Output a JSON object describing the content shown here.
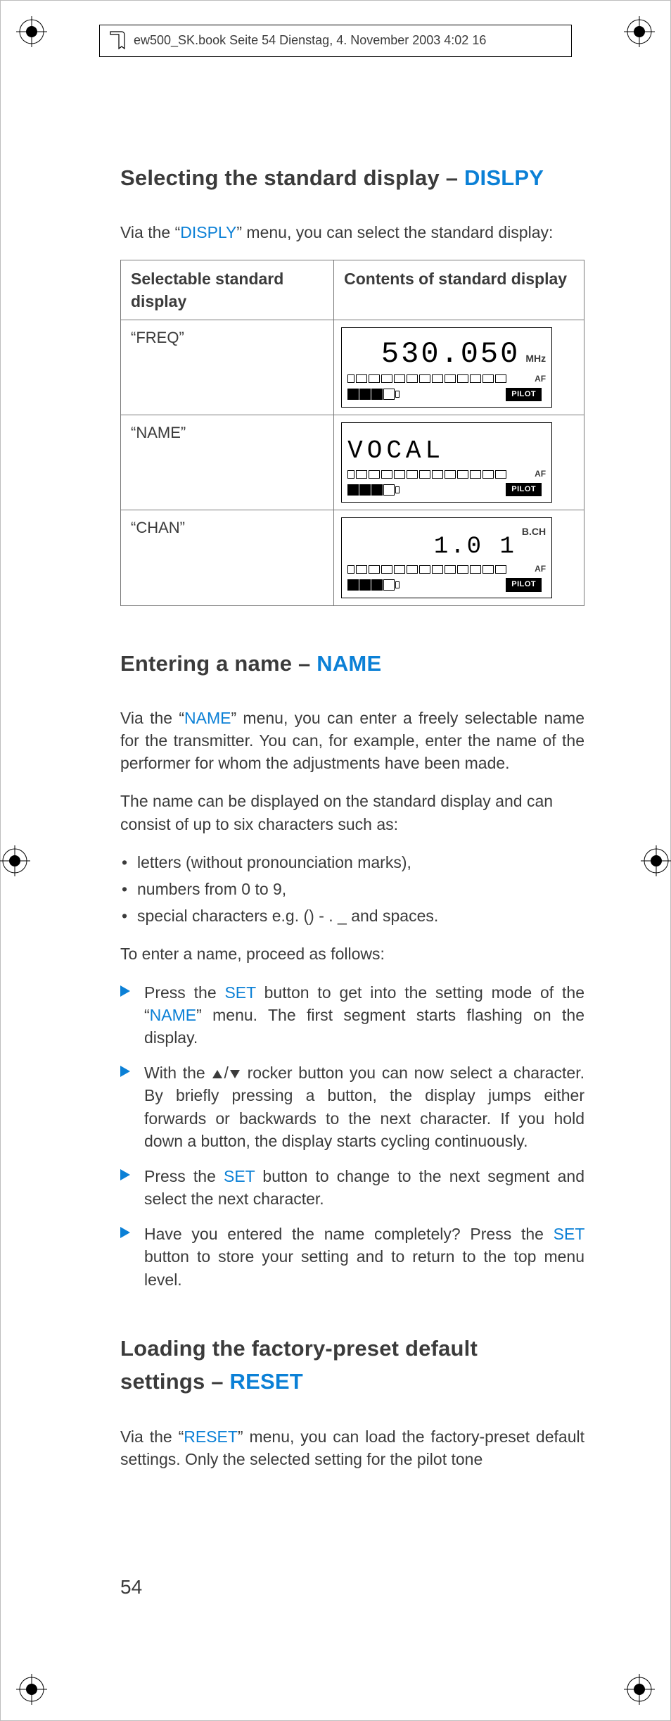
{
  "running_head": {
    "text": "ew500_SK.book  Seite 54  Dienstag, 4. November 2003  4:02 16"
  },
  "page_number": "54",
  "section1": {
    "title_pre": "Selecting the standard display – ",
    "title_hl": "DISLPY",
    "intro_pre": "Via the “",
    "intro_hl": "DISPLY",
    "intro_post": "” menu, you can select the standard display:",
    "table": {
      "header_left": "Selectable standard display",
      "header_right": "Contents of standard display",
      "rows": [
        {
          "label": "“FREQ”",
          "lcd": {
            "value": "530.050",
            "unit": "MHz",
            "af": "AF",
            "pilot": "PILOT"
          }
        },
        {
          "label": "“NAME”",
          "lcd": {
            "value": "VOCAL",
            "unit": "",
            "af": "AF",
            "pilot": "PILOT"
          }
        },
        {
          "label": "“CHAN”",
          "lcd": {
            "value": "1.0 1",
            "unit": "B.CH",
            "af": "AF",
            "pilot": "PILOT"
          }
        }
      ]
    }
  },
  "section2": {
    "title_pre": "Entering a name – ",
    "title_hl": "NAME",
    "p1_pre": "Via the “",
    "p1_hl": "NAME",
    "p1_post": "” menu, you can enter a freely selectable name for the transmitter. You can, for example, enter the name of the performer for whom the adjustments have been made.",
    "p2": "The name can be displayed on the standard display and can consist of up to six characters such as:",
    "bullets": [
      "letters (without pronounciation marks),",
      "numbers from 0 to 9,",
      "special characters e.g. () - . _ and spaces."
    ],
    "p3": "To enter a name, proceed as follows:",
    "steps": {
      "s1_pre": "Press the ",
      "s1_hl": "SET",
      "s1_mid": " button to get into the setting mode of the “",
      "s1_hl2": "NAME",
      "s1_post": "” menu. The first segment starts flashing on the display.",
      "s2_pre": "With the ",
      "s2_post": " rocker button you can now select a character. By briefly pressing a button, the display jumps either forwards or backwards to the next character. If you hold down a button, the display starts cycling continuously.",
      "s3_pre": "Press the ",
      "s3_hl": "SET",
      "s3_post": " button to change to the next segment and select the next character.",
      "s4_pre": "Have you entered the name completely? Press the ",
      "s4_hl": "SET",
      "s4_post": " button to store your setting and to return to the top menu level."
    }
  },
  "section3": {
    "title_line1": "Loading the factory-preset default",
    "title_line2_pre": "settings – ",
    "title_line2_hl": "RESET",
    "p1_pre": "Via the “",
    "p1_hl": "RESET",
    "p1_post": "” menu, you can load the factory-preset default settings. Only the selected setting for the pilot tone"
  }
}
